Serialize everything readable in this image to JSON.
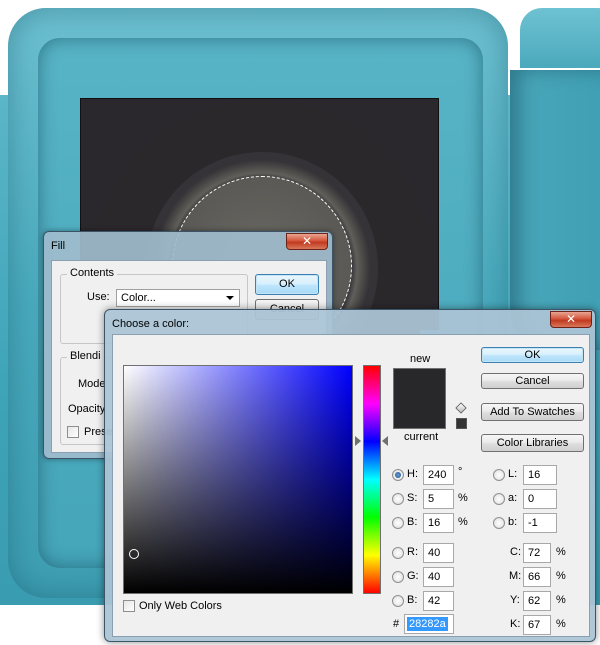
{
  "fill_dialog": {
    "title": "Fill",
    "close_glyph": "✕",
    "contents_label": "Contents",
    "use_label": "Use:",
    "use_value": "Color...",
    "ok_label": "OK",
    "cancel_label": "Cancel",
    "blending_label": "Blendi",
    "mode_label": "Mode",
    "opacity_label": "Opacity",
    "preserve_label": "Prese"
  },
  "color_picker": {
    "title": "Choose a color:",
    "close_glyph": "✕",
    "ok_label": "OK",
    "cancel_label": "Cancel",
    "add_swatches_label": "Add To Swatches",
    "color_libraries_label": "Color Libraries",
    "new_label": "new",
    "current_label": "current",
    "new_color": "#28282a",
    "current_color": "#28282a",
    "field_hue_color": "#0000ff",
    "only_web_colors_label": "Only Web Colors",
    "hsb": [
      {
        "key": "H:",
        "value": "240",
        "unit": "°",
        "selected": true
      },
      {
        "key": "S:",
        "value": "5",
        "unit": "%",
        "selected": false
      },
      {
        "key": "B:",
        "value": "16",
        "unit": "%",
        "selected": false
      }
    ],
    "rgb": [
      {
        "key": "R:",
        "value": "40"
      },
      {
        "key": "G:",
        "value": "40"
      },
      {
        "key": "B:",
        "value": "42"
      }
    ],
    "lab": [
      {
        "key": "L:",
        "value": "16"
      },
      {
        "key": "a:",
        "value": "0"
      },
      {
        "key": "b:",
        "value": "-1"
      }
    ],
    "cmyk": [
      {
        "key": "C:",
        "value": "72",
        "unit": "%"
      },
      {
        "key": "M:",
        "value": "66",
        "unit": "%"
      },
      {
        "key": "Y:",
        "value": "62",
        "unit": "%"
      },
      {
        "key": "K:",
        "value": "67",
        "unit": "%"
      }
    ],
    "hex_prefix": "#",
    "hex_value": "28282a"
  }
}
